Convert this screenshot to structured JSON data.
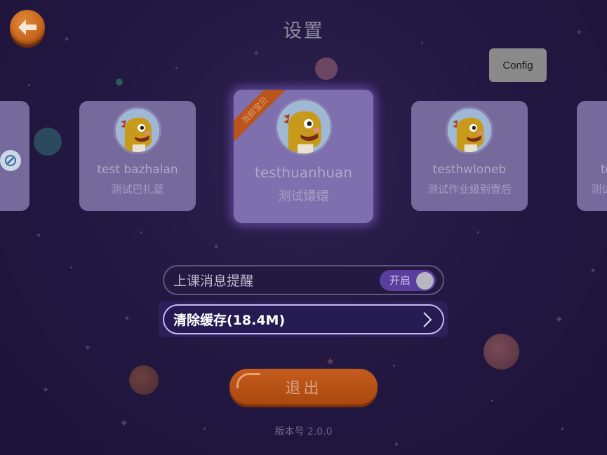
{
  "header": {
    "title": "设置",
    "back_icon": "arrow-left-icon",
    "config_label": "Config"
  },
  "profiles": [
    {
      "name": "",
      "subtitle": "",
      "icon": "edit-icon"
    },
    {
      "name": "test bazhalan",
      "subtitle": "测试巴扎蓝"
    },
    {
      "name": "testhuanhuan",
      "subtitle": "测试嬛嬛",
      "badge": "当前宝贝",
      "active": true
    },
    {
      "name": "testhwloneb",
      "subtitle": "测试作业级别壹后"
    },
    {
      "name": "te",
      "subtitle": "测试"
    }
  ],
  "settings": {
    "reminder_label": "上课消息提醒",
    "reminder_toggle_label": "开启",
    "reminder_on": true,
    "cache_label": "清除缓存(18.4M)"
  },
  "logout_label": "退出",
  "version_text": "版本号 2.0.0",
  "colors": {
    "background": "#231843",
    "card": "#76699c",
    "accent_orange": "#c55c1e",
    "toggle": "#5a3e9e"
  }
}
